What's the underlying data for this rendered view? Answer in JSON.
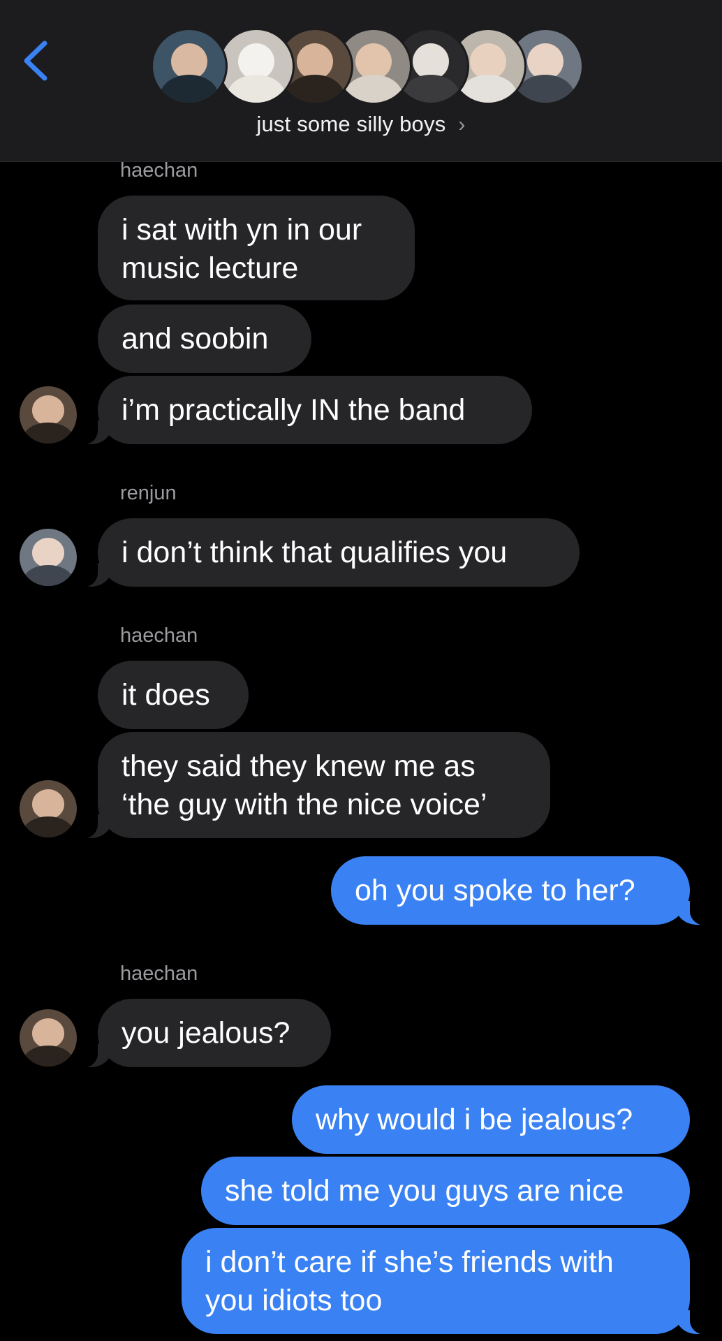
{
  "header": {
    "back_icon": "chevron-left-icon",
    "group_name": "just some silly boys",
    "chevron": "›",
    "accent": "#3a82f4",
    "avatars": [
      {
        "bg": "#3d5366",
        "face": "#d9b9a2",
        "body": "#1e2a33"
      },
      {
        "bg": "#c9c4bd",
        "face": "#f4f2ee",
        "body": "#eae7e1"
      },
      {
        "bg": "#5a4a3e",
        "face": "#d8b59a",
        "body": "#2a231e"
      },
      {
        "bg": "#8f8a84",
        "face": "#e2c4ad",
        "body": "#d8d2c8"
      },
      {
        "bg": "#2a2a2c",
        "face": "#e6e0da",
        "body": "#3b3b3e"
      },
      {
        "bg": "#bdb6ad",
        "face": "#e8d2bf",
        "body": "#e4e1dc"
      },
      {
        "bg": "#6f7782",
        "face": "#e9d3c4",
        "body": "#3f4650"
      }
    ]
  },
  "messages": {
    "m1": {
      "sender": "haechan",
      "text_line1": "i sat with yn in our",
      "text_line2": "music lecture"
    },
    "m2": {
      "text": "and soobin"
    },
    "m3": {
      "text": "i’m practically IN the band"
    },
    "m4": {
      "sender": "renjun",
      "text": "i don’t think that qualifies you"
    },
    "m5": {
      "sender": "haechan",
      "text": "it does"
    },
    "m6": {
      "text_line1": "they said they knew me as",
      "text_line2": "‘the guy with the nice voice’"
    },
    "m7": {
      "text": "oh you spoke to her?"
    },
    "m8": {
      "sender": "haechan",
      "text": "you jealous?"
    },
    "m9": {
      "text": "why would i be jealous?"
    },
    "m10": {
      "text": "she told me you guys are nice"
    },
    "m11": {
      "text_line1": "i don’t care if she’s friends with",
      "text_line2": "you idiots too"
    }
  },
  "member_avatars": {
    "haechan": {
      "bg": "#5a4a3e",
      "face": "#d8b59a",
      "body": "#2a231e"
    },
    "renjun": {
      "bg": "#6f7782",
      "face": "#e9d3c4",
      "body": "#3f4650"
    }
  }
}
